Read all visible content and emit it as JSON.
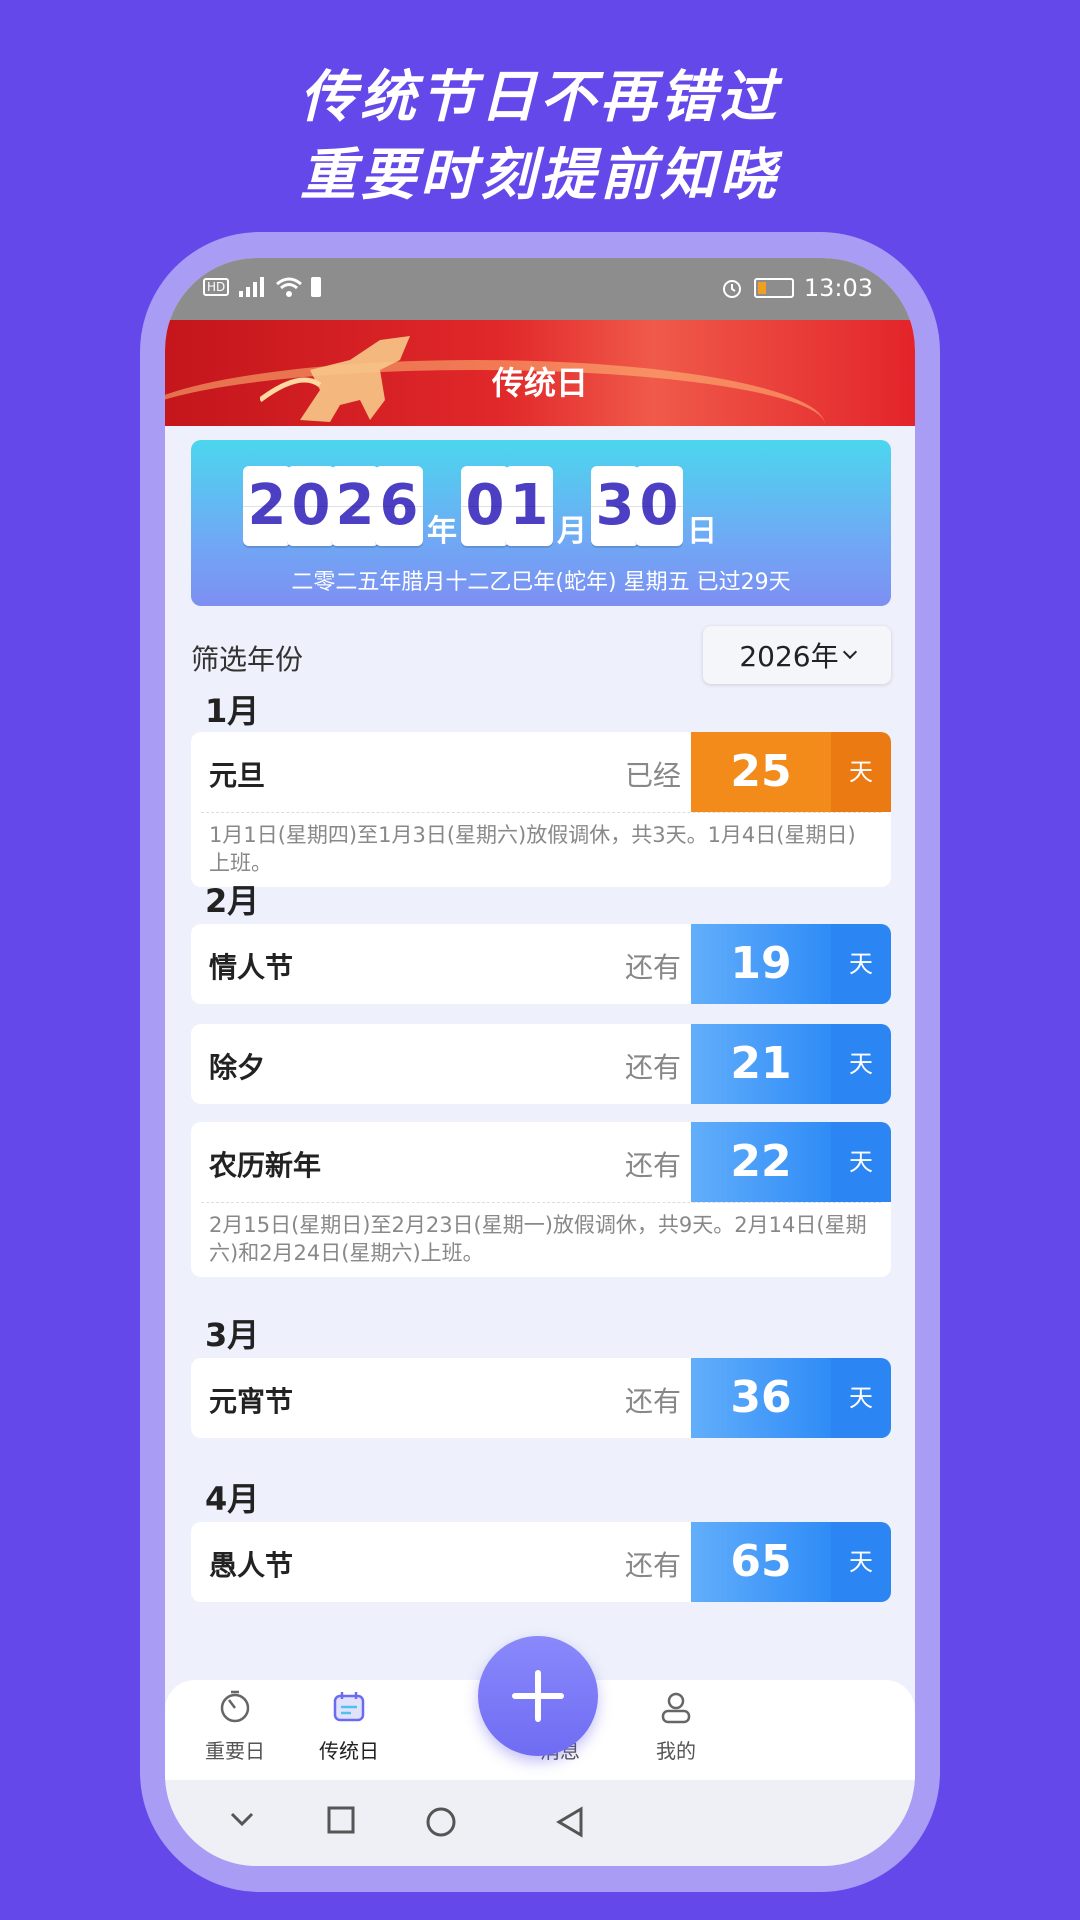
{
  "promo": {
    "line1": "传统节日不再错过",
    "line2": "重要时刻提前知晓"
  },
  "statusbar": {
    "left_icons": [
      "hd-icon",
      "signal-icon",
      "wifi-icon",
      "alert-icon"
    ],
    "time": "13:03"
  },
  "header": {
    "title": "传统日"
  },
  "date_card": {
    "year_digits": [
      "2",
      "0",
      "2",
      "6"
    ],
    "year_unit": "年",
    "month_digits": [
      "0",
      "1"
    ],
    "month_unit": "月",
    "day_digits": [
      "3",
      "0"
    ],
    "day_unit": "日",
    "lunar_text": "二零二五年腊月十二乙巳年(蛇年)   星期五   已过29天"
  },
  "filter": {
    "label": "筛选年份",
    "value": "2026年"
  },
  "months": [
    "1月",
    "2月",
    "3月",
    "4月"
  ],
  "holidays": [
    {
      "name": "元旦",
      "state": "已经",
      "count": "25",
      "unit": "天",
      "color": "#f28b1a",
      "note": "1月1日(星期四)至1月3日(星期六)放假调休，共3天。1月4日(星期日)上班。"
    },
    {
      "name": "情人节",
      "state": "还有",
      "count": "19",
      "unit": "天",
      "color": "#2f8cf6"
    },
    {
      "name": "除夕",
      "state": "还有",
      "count": "21",
      "unit": "天",
      "color": "#2f8cf6"
    },
    {
      "name": "农历新年",
      "state": "还有",
      "count": "22",
      "unit": "天",
      "color": "#2f8cf6",
      "note": "2月15日(星期日)至2月23日(星期一)放假调休，共9天。2月14日(星期六)和2月24日(星期六)上班。"
    },
    {
      "name": "元宵节",
      "state": "还有",
      "count": "36",
      "unit": "天",
      "color": "#2f8cf6"
    },
    {
      "name": "愚人节",
      "state": "还有",
      "count": "65",
      "unit": "天",
      "color": "#2f8cf6"
    }
  ],
  "tabs": [
    {
      "label": "重要日",
      "icon": "timer-icon"
    },
    {
      "label": "传统日",
      "icon": "calendar-icon"
    },
    {
      "label": "消息",
      "icon": "chat-icon"
    },
    {
      "label": "我的",
      "icon": "user-icon"
    }
  ],
  "colors": {
    "background": "#6448ea",
    "accent_blue": "#2f8cf6",
    "accent_orange": "#f28b1a"
  }
}
